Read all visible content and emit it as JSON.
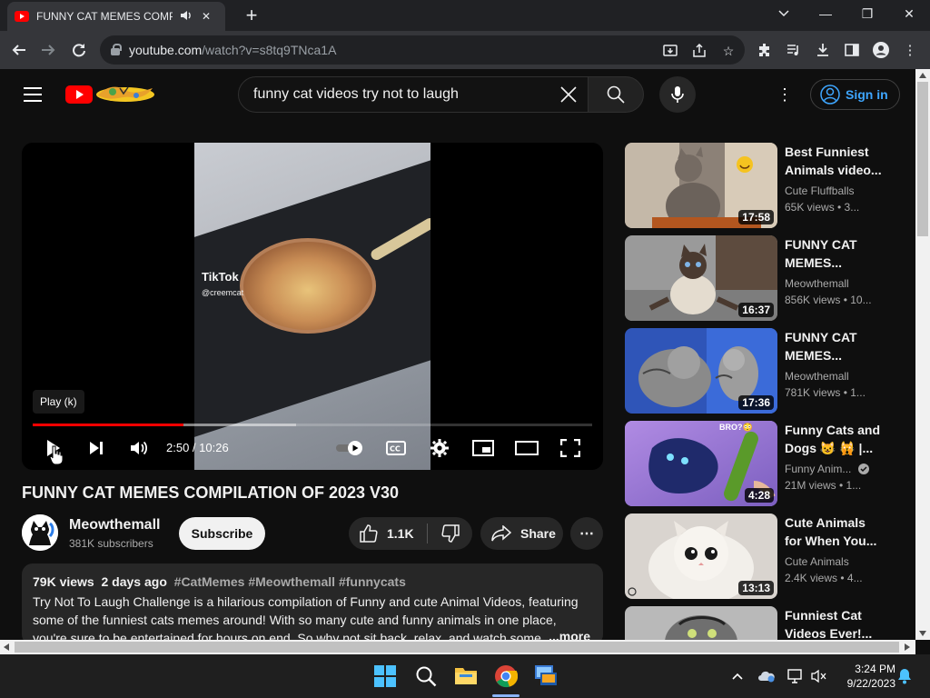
{
  "browser": {
    "tab_title": "FUNNY CAT MEMES COMPILATION OF 2023 V30",
    "url_host": "youtube.com",
    "url_path": "/watch?v=s8tq9TNca1A",
    "new_tab_symbol": "+",
    "minimize_symbol": "—",
    "maximize_symbol": "❐",
    "close_symbol": "✕"
  },
  "header": {
    "search_query": "funny cat videos try not to laugh",
    "sign_in_label": "Sign in"
  },
  "player": {
    "tooltip": "Play (k)",
    "time_current": "2:50",
    "time_total": "10:26",
    "time_display": "2:50 / 10:26",
    "progress_played_fraction": 0.27,
    "progress_loaded_fraction": 0.47,
    "watermark_brand": "TikTok",
    "watermark_handle": "@creemcat"
  },
  "video": {
    "title": "FUNNY CAT MEMES COMPILATION OF 2023 V30",
    "channel_name": "Meowthemall",
    "subscribers": "381K subscribers",
    "subscribe_label": "Subscribe",
    "like_count": "1.1K",
    "share_label": "Share",
    "views": "79K views",
    "posted": "2 days ago",
    "hashtags": "#CatMemes #Meowthemall #funnycats",
    "description": "Try Not To Laugh Challenge is a hilarious compilation of Funny and cute Animal Videos, featuring some of the funniest cats memes around! With so many cute and funny animals in one place, you're sure to be entertained for hours on end. So why not sit back, relax, and watch some c",
    "more_label": "...more"
  },
  "recommendations": [
    {
      "title": "Best Funniest Animals video...",
      "channel": "Cute Fluffballs",
      "stats": "65K views • 3...",
      "duration": "17:58"
    },
    {
      "title": "FUNNY CAT MEMES...",
      "channel": "Meowthemall",
      "stats": "856K views • 10...",
      "duration": "16:37"
    },
    {
      "title": "FUNNY CAT MEMES...",
      "channel": "Meowthemall",
      "stats": "781K views • 1...",
      "duration": "17:36"
    },
    {
      "title": "Funny Cats and Dogs 😺 🙀 |...",
      "channel": "Funny Anim...",
      "stats": "21M views • 1...",
      "duration": "4:28",
      "verified": true
    },
    {
      "title": "Cute Animals for When You...",
      "channel": "Cute Animals",
      "stats": "2.4K views • 4...",
      "duration": "13:13"
    },
    {
      "title": "Funniest Cat Videos Ever!...",
      "channel": "",
      "stats": "",
      "duration": ""
    }
  ],
  "thumb_overlay_text": {
    "rec4": "BRO?😳"
  },
  "taskbar": {
    "time": "3:24 PM",
    "date": "9/22/2023"
  },
  "colors": {
    "accent_red": "#ff0000",
    "link_blue": "#3ea6ff",
    "page_bg": "#0f0f0f"
  }
}
